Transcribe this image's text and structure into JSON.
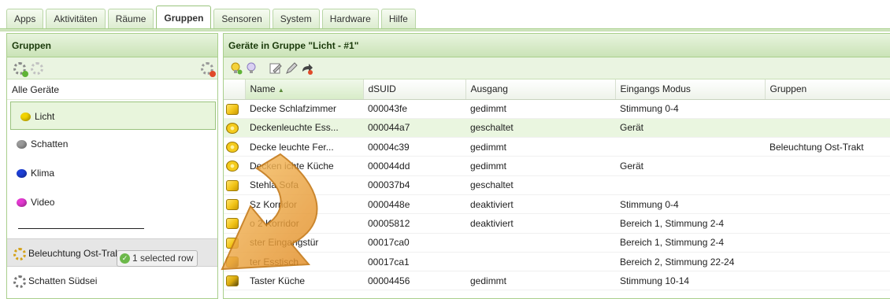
{
  "tabs": [
    "Apps",
    "Aktivitäten",
    "Räume",
    "Gruppen",
    "Sensoren",
    "System",
    "Hardware",
    "Hilfe"
  ],
  "active_tab_index": 3,
  "left": {
    "title": "Gruppen",
    "all_devices": "Alle Geräte",
    "groups": [
      {
        "label": "Licht",
        "color": "#f2d300",
        "selected": true
      },
      {
        "label": "Schatten",
        "color": "#9a9a9a"
      },
      {
        "label": "Klima",
        "color": "#1d3fd6"
      },
      {
        "label": "Video",
        "color": "#e43ad2"
      }
    ],
    "clusters": [
      {
        "label": "Beleuchtung Ost-Trakt"
      },
      {
        "label": "Schatten Südsei"
      }
    ],
    "status_badge": "1 selected row"
  },
  "right": {
    "title": "Geräte in Gruppe \"Licht - #1\"",
    "columns": [
      "Name",
      "dSUID",
      "Ausgang",
      "Eingangs Modus",
      "Gruppen"
    ],
    "sort_indicator": "▲",
    "rows": [
      {
        "name": "Decke Schlafzimmer",
        "dsuid": "000043fe",
        "ausgang": "gedimmt",
        "modus": "Stimmung 0-4",
        "gruppen": "",
        "icon": "cube"
      },
      {
        "name": "Deckenleuchte Ess...",
        "dsuid": "000044a7",
        "ausgang": "geschaltet",
        "modus": "Gerät",
        "gruppen": "",
        "icon": "flower"
      },
      {
        "name": "Decke  leuchte Fer...",
        "dsuid": "00004c39",
        "ausgang": "gedimmt",
        "modus": "",
        "gruppen": "Beleuchtung Ost-Trakt",
        "icon": "flower"
      },
      {
        "name": "Decken  ichte Küche",
        "dsuid": "000044dd",
        "ausgang": "gedimmt",
        "modus": "Gerät",
        "gruppen": "",
        "icon": "flower"
      },
      {
        "name": "Stehla     Sofa",
        "dsuid": "000037b4",
        "ausgang": "geschaltet",
        "modus": "",
        "gruppen": "",
        "icon": "cube"
      },
      {
        "name": "Sz        Korridor",
        "dsuid": "0000448e",
        "ausgang": "deaktiviert",
        "modus": "Stimmung 0-4",
        "gruppen": "",
        "icon": "cube"
      },
      {
        "name": "         o 2 Korridor",
        "dsuid": "00005812",
        "ausgang": "deaktiviert",
        "modus": "Bereich 1, Stimmung 2-4",
        "gruppen": "",
        "icon": "cube"
      },
      {
        "name": "    ster Eingangstür",
        "dsuid": "00017ca0",
        "ausgang": "",
        "modus": "Bereich 1, Stimmung 2-4",
        "gruppen": "",
        "icon": "cube"
      },
      {
        "name": "    ter Esstisch",
        "dsuid": "00017ca1",
        "ausgang": "",
        "modus": "Bereich 2, Stimmung 22-24",
        "gruppen": "",
        "icon": "dark"
      },
      {
        "name": "Taster Küche",
        "dsuid": "00004456",
        "ausgang": "gedimmt",
        "modus": "Stimmung 10-14",
        "gruppen": "",
        "icon": "dark"
      }
    ]
  },
  "colors": {
    "accent_green": "#a9cf8c",
    "highlight_row": "#eaf6e0",
    "arrow": "#f0a640"
  }
}
